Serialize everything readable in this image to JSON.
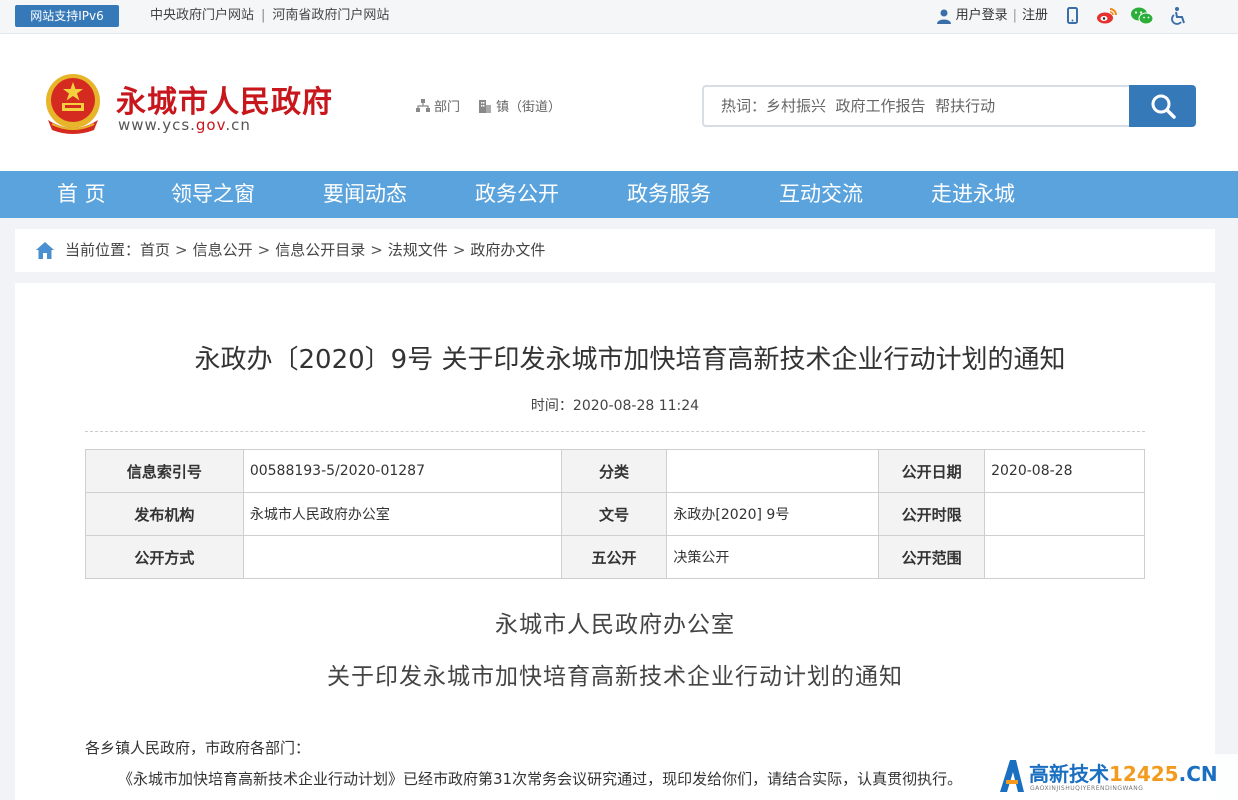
{
  "topbar": {
    "ipv6": "网站支持IPv6",
    "link1": "中央政府门户网站",
    "sep": "|",
    "link2": "河南省政府门户网站",
    "login": "用户登录",
    "register": "注册"
  },
  "header": {
    "site_name": "永城市人民政府",
    "url_pre": "www.ycs.",
    "url_gov": "gov",
    "url_post": ".cn",
    "quick1": "部门",
    "quick2": "镇（街道）",
    "search_placeholder": "热词：乡村振兴  政府工作报告  帮扶行动"
  },
  "nav": [
    "首 页",
    "领导之窗",
    "要闻动态",
    "政务公开",
    "政务服务",
    "互动交流",
    "走进永城"
  ],
  "breadcrumb": {
    "label": "当前位置：",
    "items": [
      "首页",
      "信息公开",
      "信息公开目录",
      "法规文件",
      "政府办文件"
    ],
    "sep": ">"
  },
  "article": {
    "title": "永政办〔2020〕9号 关于印发永城市加快培育高新技术企业行动计划的通知",
    "time": "时间：2020-08-28 11:24",
    "meta": {
      "rows": [
        [
          {
            "k": "信息索引号",
            "v": "00588193-5/2020-01287"
          },
          {
            "k": "分类",
            "v": ""
          },
          {
            "k": "公开日期",
            "v": "2020-08-28"
          }
        ],
        [
          {
            "k": "发布机构",
            "v": "永城市人民政府办公室"
          },
          {
            "k": "文号",
            "v": "永政办[2020] 9号"
          },
          {
            "k": "公开时限",
            "v": ""
          }
        ],
        [
          {
            "k": "公开方式",
            "v": ""
          },
          {
            "k": "五公开",
            "v": "决策公开"
          },
          {
            "k": "公开范围",
            "v": ""
          }
        ]
      ]
    },
    "org": "永城市人民政府办公室",
    "doc_title": "关于印发永城市加快培育高新技术企业行动计划的通知",
    "greeting": "各乡镇人民政府，市政府各部门：",
    "paragraph": "《永城市加快培育高新技术企业行动计划》已经市政府第31次常务会议研究通过，现印发给你们，请结合实际，认真贯彻执行。"
  },
  "watermark": {
    "brand_a": "高新技术",
    "brand_b": "12425",
    "brand_c": ".CN",
    "sub": "GAOXINJISHUQIYERENDINGWANG"
  },
  "icons": {
    "user": "user-icon",
    "phone": "mobile-icon",
    "weibo": "weibo-icon",
    "wechat": "wechat-icon",
    "access": "accessibility-icon",
    "search": "search-icon",
    "home": "home-icon"
  },
  "colors": {
    "brand_red": "#c8161d",
    "nav_blue": "#5ba3dc",
    "accent_blue": "#3679b8"
  }
}
